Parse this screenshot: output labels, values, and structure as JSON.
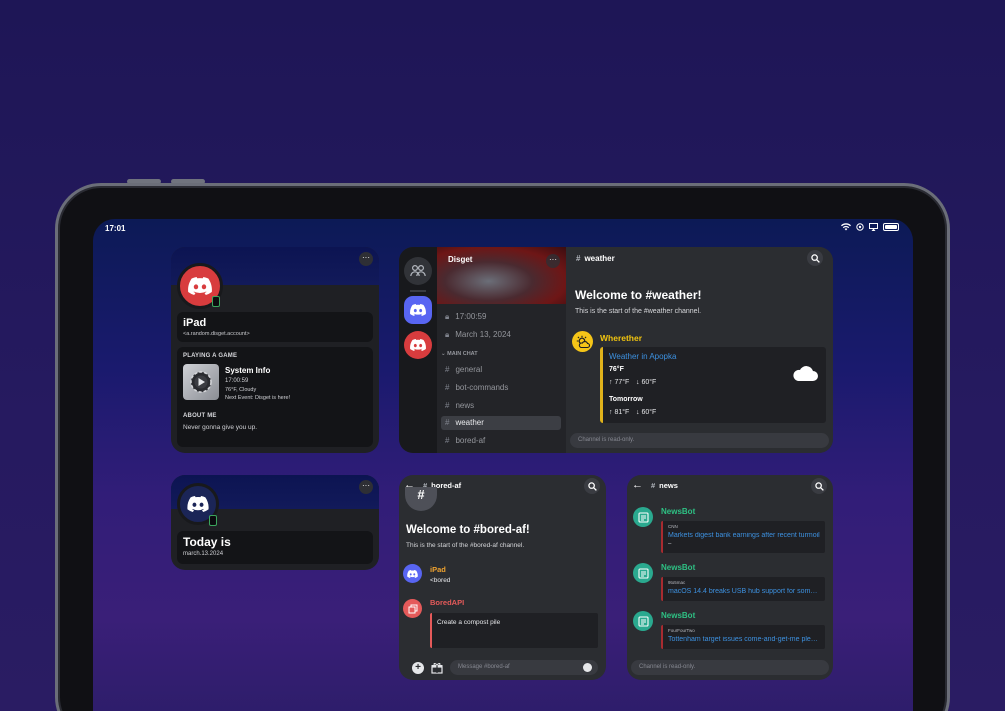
{
  "status_bar": {
    "time": "17:01"
  },
  "profile_widget": {
    "device_name": "iPad",
    "account": "<a.random.disget.account>",
    "playing_header": "PLAYING A GAME",
    "game_title": "System Info",
    "game_line1": "17:00:59",
    "game_line2": "76°F, Cloudy",
    "game_line3": "Next Event: Disget is here!",
    "about_header": "ABOUT ME",
    "about_text": "Never gonna give you up."
  },
  "date_widget": {
    "title": "Today is",
    "date": "march.13.2024"
  },
  "main_panel": {
    "server_name": "Disget",
    "time_channel": "17:00:59",
    "date_channel": "March 13, 2024",
    "category": "MAIN CHAT",
    "channels": [
      "general",
      "bot-commands",
      "news",
      "weather",
      "bored-af"
    ],
    "active_channel": "weather",
    "chat_header": "weather",
    "welcome": "Welcome to #weather!",
    "welcome_sub": "This is the start of the #weather channel.",
    "bot_name": "Wherether",
    "embed_title": "Weather in Apopka",
    "current_temp": "76°F",
    "today_high": "↑ 77°F",
    "today_low": "↓ 60°F",
    "tomorrow_label": "Tomorrow",
    "tomorrow_high": "↑ 81°F",
    "tomorrow_low": "↓ 60°F",
    "input_placeholder": "Channel is read-only.",
    "embed_color": "#e0b21b"
  },
  "bored_panel": {
    "header": "bored-af",
    "welcome": "Welcome to #bored-af!",
    "welcome_sub": "This is the start of the #bored-af channel.",
    "user1_name": "iPad",
    "user1_msg": "<bored",
    "user2_name": "BoredAPI",
    "embed_text": "Create a compost pile",
    "input_placeholder": "Message #bored-af"
  },
  "news_panel": {
    "header": "news",
    "items": [
      {
        "bot": "NewsBot",
        "source": "CNN",
        "title": "Markets digest bank earnings after recent turmoil",
        "extra": "–"
      },
      {
        "bot": "NewsBot",
        "source": "9to5mac",
        "title": "macOS 14.4 breaks USB hub support for some e..."
      },
      {
        "bot": "NewsBot",
        "source": "FourFourTwo",
        "title": "Tottenham target issues come-and-get-me plea..."
      }
    ],
    "input_placeholder": "Channel is read-only."
  }
}
